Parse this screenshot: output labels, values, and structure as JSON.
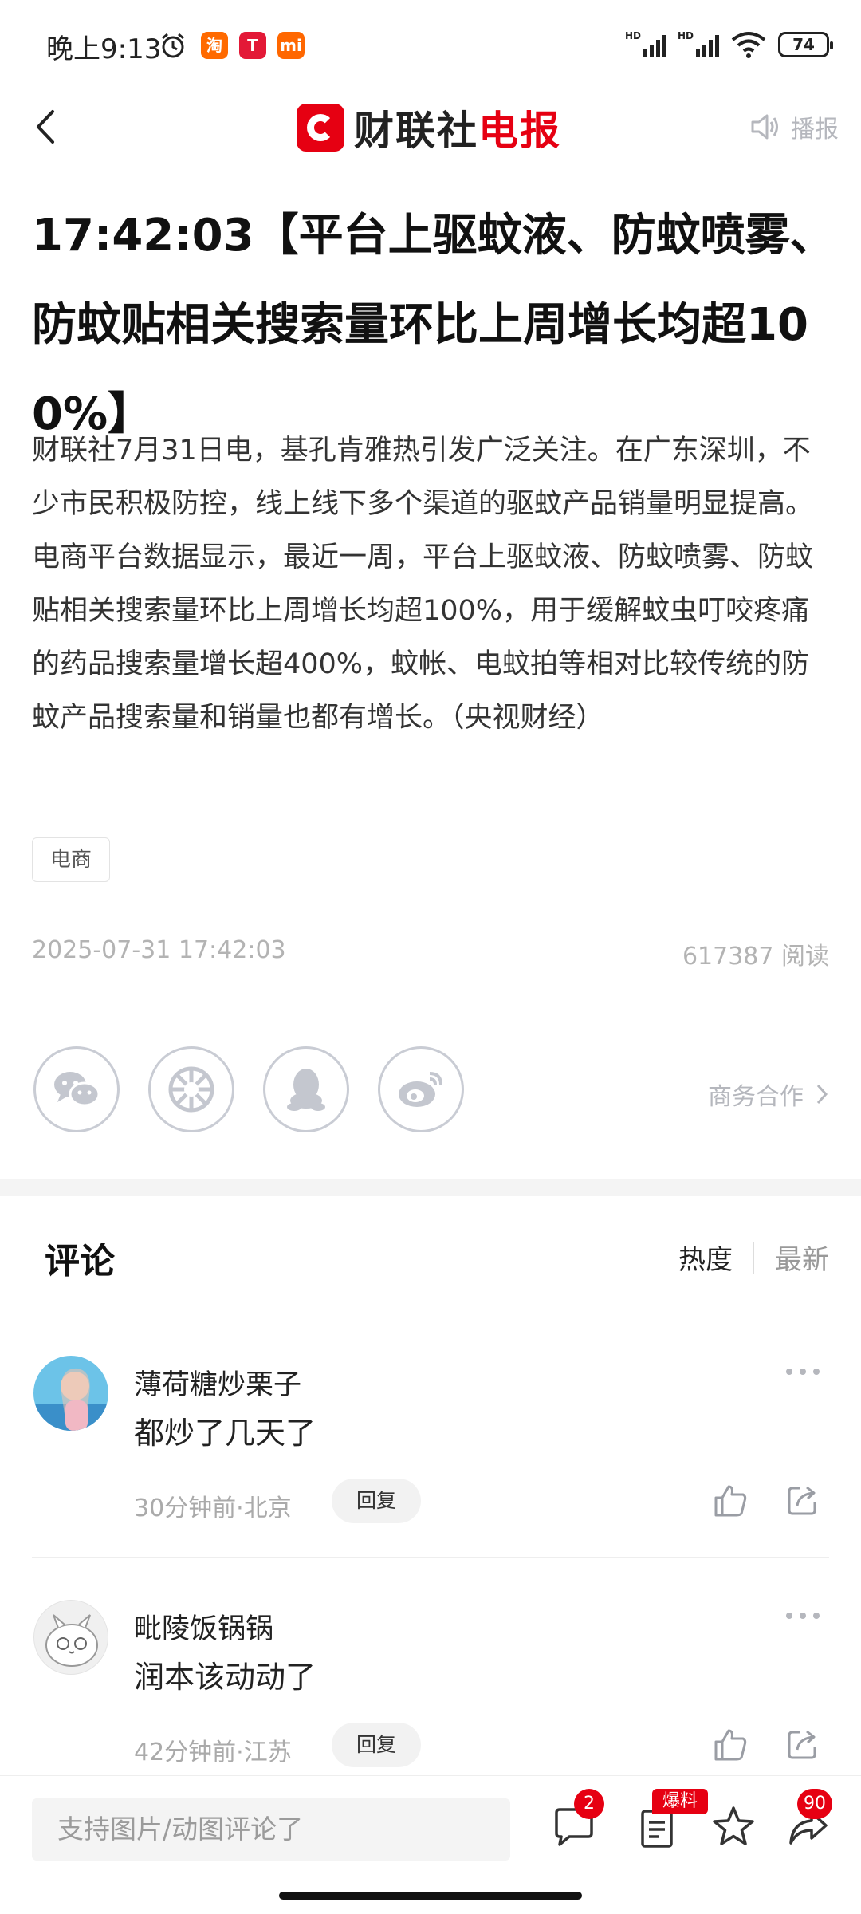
{
  "status_bar": {
    "time": "晚上9:13",
    "battery": "74",
    "network_labels": [
      "HD",
      "HD"
    ],
    "app_icons": [
      {
        "name": "taobao-icon",
        "glyph": "淘",
        "color": "#ff6a00"
      },
      {
        "name": "tesla-icon",
        "glyph": "T",
        "color": "#e31937"
      },
      {
        "name": "mi-icon",
        "glyph": "mi",
        "color": "#ff6700"
      }
    ]
  },
  "nav": {
    "logo_text_black": "财联社",
    "logo_text_red": "电报",
    "broadcast_label": "播报"
  },
  "article": {
    "headline": "17:42:03【平台上驱蚊液、防蚊喷雾、防蚊贴相关搜索量环比上周增长均超100%】",
    "body": "财联社7月31日电，基孔肯雅热引发广泛关注。在广东深圳，不少市民积极防控，线上线下多个渠道的驱蚊产品销量明显提高。电商平台数据显示，最近一周，平台上驱蚊液、防蚊喷雾、防蚊贴相关搜索量环比上周增长均超100%，用于缓解蚊虫叮咬疼痛的药品搜索量增长超400%，蚊帐、电蚊拍等相对比较传统的防蚊产品搜索量和销量也都有增长。（央视财经）",
    "tag": "电商",
    "datetime": "2025-07-31 17:42:03",
    "reads": "617387 阅读"
  },
  "share": {
    "buttons": [
      "wechat-icon",
      "moments-icon",
      "qq-icon",
      "weibo-icon"
    ],
    "business_label": "商务合作"
  },
  "comments": {
    "title": "评论",
    "sort_hot": "热度",
    "sort_new": "最新",
    "reply_label": "回复",
    "items": [
      {
        "user": "薄荷糖炒栗子",
        "text": "都炒了几天了",
        "meta": "30分钟前·北京"
      },
      {
        "user": "毗陵饭锅锅",
        "text": "润本该动动了",
        "meta": "42分钟前·江苏"
      }
    ]
  },
  "bottom_bar": {
    "input_placeholder": "支持图片/动图评论了",
    "comment_count": "2",
    "baoliao_label": "爆料",
    "share_count": "90"
  },
  "colors": {
    "brand_red": "#e60012",
    "muted": "#b3b3b3",
    "icon_gray": "#c9ccd4"
  }
}
